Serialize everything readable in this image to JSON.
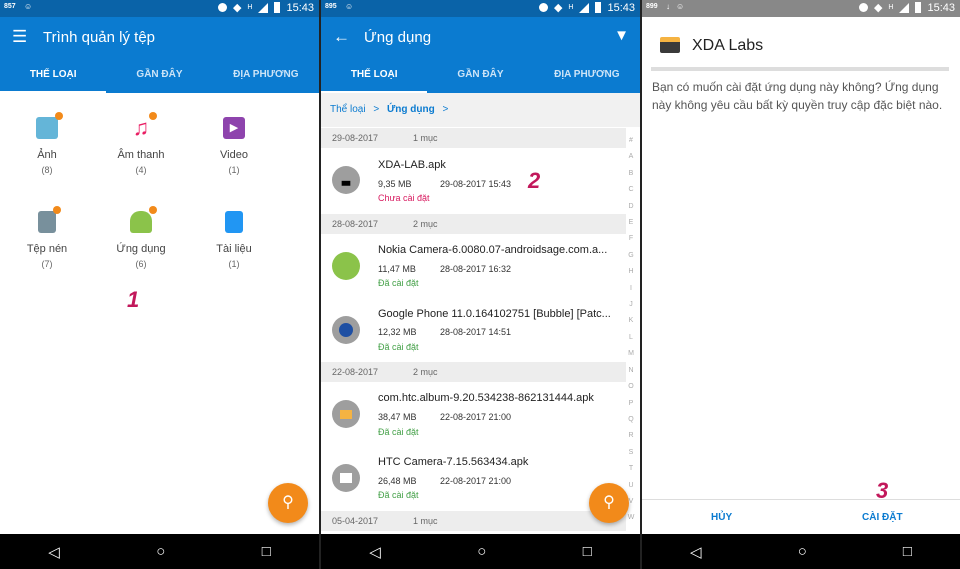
{
  "panel1": {
    "status": {
      "left": "857",
      "time": "15:43",
      "signal": "H"
    },
    "title": "Trình quản lý tệp",
    "tabs": [
      "THỂ LOẠI",
      "GẦN ĐÂY",
      "ĐỊA PHƯƠNG"
    ],
    "categories": [
      {
        "name": "Ảnh",
        "count": "(8)",
        "icon": "image-icon",
        "color": "#64b5d8"
      },
      {
        "name": "Âm thanh",
        "count": "(4)",
        "icon": "music-icon",
        "color": "#e91e63"
      },
      {
        "name": "Video",
        "count": "(1)",
        "icon": "video-icon",
        "color": "#8e44ad"
      },
      {
        "name": "Tệp nén",
        "count": "(7)",
        "icon": "zip-icon",
        "color": "#78909c"
      },
      {
        "name": "Ứng dụng",
        "count": "(6)",
        "icon": "android-icon",
        "color": "#8bc34a"
      },
      {
        "name": "Tài liệu",
        "count": "(1)",
        "icon": "document-icon",
        "color": "#2196f3"
      }
    ],
    "step": "1"
  },
  "panel2": {
    "status": {
      "left": "895",
      "time": "15:43",
      "signal": "H"
    },
    "title": "Ứng dụng",
    "tabs": [
      "THỂ LOẠI",
      "GẦN ĐÂY",
      "ĐỊA PHƯƠNG"
    ],
    "breadcrumb": [
      "Thể loại",
      ">",
      "Ứng dụng",
      ">"
    ],
    "groups": [
      {
        "date": "29-08-2017",
        "count": "1 mục"
      },
      {
        "date": "28-08-2017",
        "count": "2 mục"
      },
      {
        "date": "22-08-2017",
        "count": "2 mục"
      },
      {
        "date": "05-04-2017",
        "count": "1 mục"
      }
    ],
    "apps": [
      {
        "name": "XDA-LAB.apk",
        "size": "9,35 MB",
        "date": "29-08-2017 15:43",
        "status": "Chưa cài đặt",
        "status_color": "#d81b60",
        "icon": "xda-basket-icon",
        "color": "#9e9e9e"
      },
      {
        "name": "Nokia Camera-6.0080.07-androidsage.com.a...",
        "size": "11,47 MB",
        "date": "28-08-2017 16:32",
        "status": "Đã cài đặt",
        "status_color": "#43a047",
        "icon": "android-icon",
        "color": "#8bc34a"
      },
      {
        "name": "Google Phone 11.0.164102751 [Bubble] [Patc...",
        "size": "12,32 MB",
        "date": "28-08-2017 14:51",
        "status": "Đã cài đặt",
        "status_color": "#43a047",
        "icon": "phone-icon",
        "color": "#9e9e9e"
      },
      {
        "name": "com.htc.album-9.20.534238-862131444.apk",
        "size": "38,47 MB",
        "date": "22-08-2017 21:00",
        "status": "Đã cài đặt",
        "status_color": "#43a047",
        "icon": "album-icon",
        "color": "#9e9e9e"
      },
      {
        "name": "HTC Camera-7.15.563434.apk",
        "size": "26,48 MB",
        "date": "22-08-2017 21:00",
        "status": "Đã cài đặt",
        "status_color": "#43a047",
        "icon": "camera-icon",
        "color": "#9e9e9e"
      }
    ],
    "alphabet": "# A B C D E F G H I J K L M N O P Q R S T U V W",
    "step": "2"
  },
  "panel3": {
    "status": {
      "left": "899",
      "time": "15:43",
      "signal": "H"
    },
    "title": "XDA Labs",
    "message": "Bạn có muốn cài đặt ứng dụng này không? Ứng dụng này không yêu cầu bất kỳ quyền truy cập đặc biệt nào.",
    "cancel": "HỦY",
    "install": "CÀI ĐẶT",
    "step": "3"
  },
  "nav": {
    "back": "◁",
    "home": "○",
    "recents": "□"
  },
  "colors": {
    "primary": "#0b7bd0",
    "accent": "#f28a1a",
    "status_bar": "#0a63a8"
  }
}
